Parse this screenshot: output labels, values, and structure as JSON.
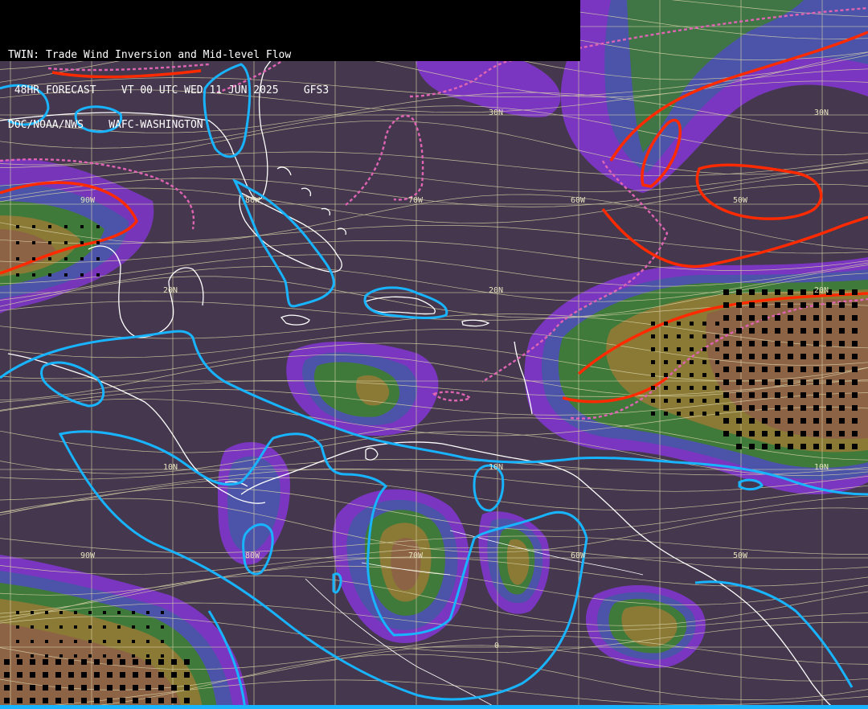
{
  "header": {
    "title": "TWIN: Trade Wind Inversion and Mid-level Flow",
    "forecast": " 48HR FORECAST    VT 00 UTC WED 11 JUN 2025    GFS3",
    "issuer": "DOC/NOAA/NWS    WAFC-WASHINGTON"
  },
  "labels": {
    "lat30n": "30N",
    "lat30n_east": "30N",
    "lat20n": "20N",
    "lat20n_mid": "20N",
    "lat20n_east": "20N",
    "lat10n": "10N",
    "lat10n_mid": "10N",
    "lat10n_east": "10N",
    "lat0": "0",
    "lon90w_top": "90W",
    "lon80w_top": "80W",
    "lon70w_top": "70W",
    "lon60w_top": "60W",
    "lon50w_top": "50W",
    "lon90w_bot": "90W",
    "lon80w_bot": "80W",
    "lon70w_bot": "70W",
    "lon60w_bot": "60W",
    "lon50w_bot": "50W"
  },
  "colors": {
    "background": "#45384e",
    "purple_band": "#7a36c0",
    "blue_band": "#4b54a8",
    "green_band": "#3f7a3a",
    "olive_band": "#8a7a35",
    "brown_band": "#8d6345",
    "red_contour": "#ff2a00",
    "pink_dashed": "#e064b4",
    "cyan_contour": "#18b4ff",
    "coastline": "#ffffff",
    "streamline": "#d9d3a8"
  }
}
